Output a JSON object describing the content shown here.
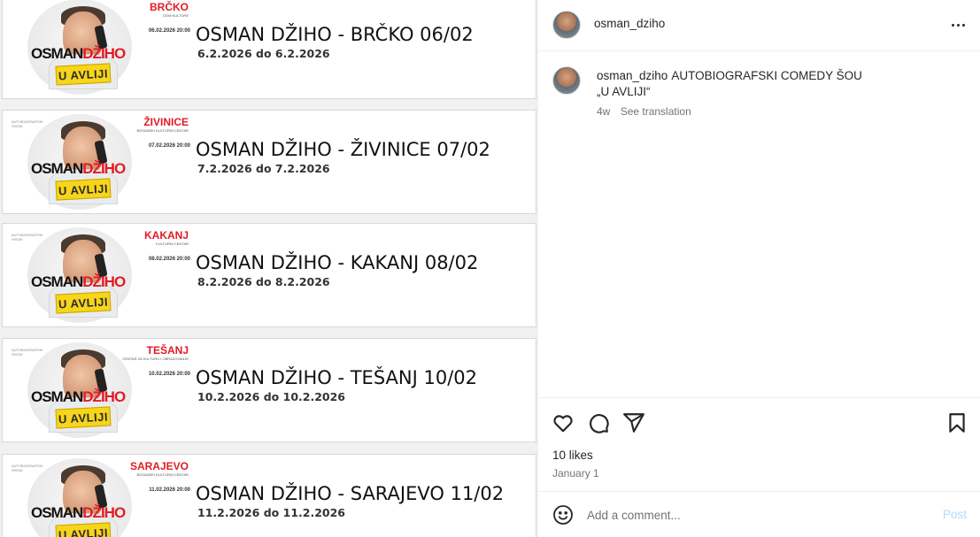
{
  "post": {
    "events": [
      {
        "title": "OSMAN DŽIHO - BRČKO 06/02",
        "dates": "6.2.2026 do 6.2.2026",
        "city": "BRČKO",
        "venue": "DOM KULTURE",
        "poster_date": "06.02.2026 20:00"
      },
      {
        "title": "OSMAN DŽIHO - ŽIVINICE 07/02",
        "dates": "7.2.2026 do 7.2.2026",
        "city": "ŽIVINICE",
        "venue": "BOSANSKI KULTURNI CENTAR",
        "poster_date": "07.02.2026 20:00"
      },
      {
        "title": "OSMAN DŽIHO - KAKANJ 08/02",
        "dates": "8.2.2026 do 8.2.2026",
        "city": "KAKANJ",
        "venue": "KULTURNI CENTAR",
        "poster_date": "08.02.2026 20:00"
      },
      {
        "title": "OSMAN DŽIHO - TEŠANJ 10/02",
        "dates": "10.2.2026 do 10.2.2026",
        "city": "TEŠANJ",
        "venue": "CENTAR ZA KULTURU I OBRAZOVANJE",
        "poster_date": "10.02.2026 20:00"
      },
      {
        "title": "OSMAN DŽIHO - SARAJEVO 11/02",
        "dates": "11.2.2026 do 11.2.2026",
        "city": "SARAJEVO",
        "venue": "BOSANSKI KULTURNI CENTAR",
        "poster_date": "11.02.2026 20:00"
      }
    ],
    "poster_logo_black": "OSMAN",
    "poster_logo_red": "DŽIHO",
    "poster_badge": "U AVLIJI",
    "poster_tag": "AUTOBIOGRAFSKI SHOW"
  },
  "header": {
    "username": "osman_dziho",
    "more_icon": "more-horizontal-icon"
  },
  "caption": {
    "username": "osman_dziho",
    "line1": "AUTOBIOGRAFSKI COMEDY ŠOU",
    "line2": "„U AVLIJI“",
    "age": "4w",
    "see_translation": "See translation"
  },
  "actions": {
    "icons": [
      "heart-icon",
      "comment-icon",
      "share-icon",
      "bookmark-icon"
    ]
  },
  "likes": "10 likes",
  "date": "January 1",
  "comment": {
    "placeholder": "Add a comment...",
    "post_label": "Post",
    "emoji_icon": "emoji-icon"
  },
  "colors": {
    "accent_red": "#e21b25",
    "badge_yellow": "#f7d51b",
    "post_button_disabled": "#b3dbff",
    "secondary_text": "#737373"
  }
}
